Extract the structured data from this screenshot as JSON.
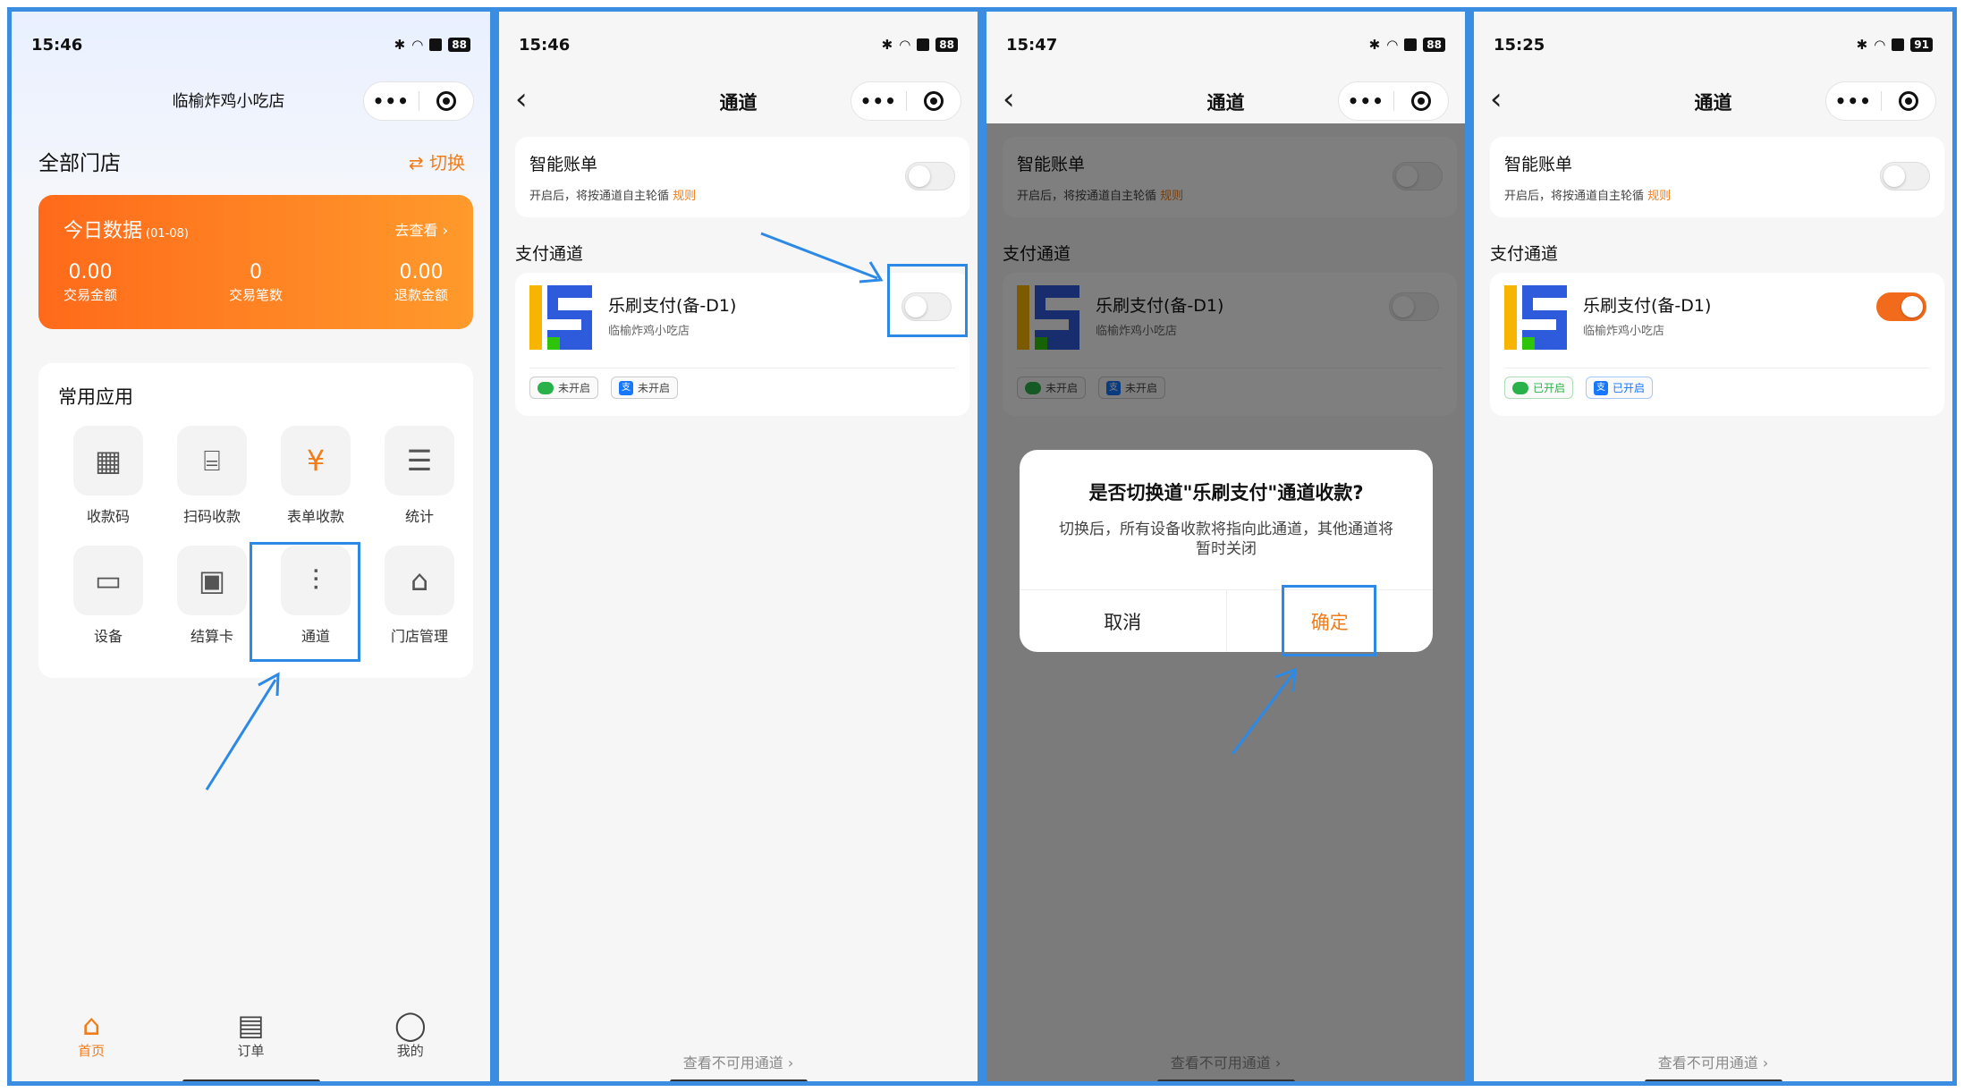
{
  "status": {
    "panel1": {
      "time": "15:46",
      "battery": "88"
    },
    "panel2": {
      "time": "15:46",
      "battery": "88"
    },
    "panel3": {
      "time": "15:47",
      "battery": "88"
    },
    "panel4": {
      "time": "15:25",
      "battery": "91"
    }
  },
  "home": {
    "store_name": "临榆炸鸡小吃店",
    "all_stores": "全部门店",
    "switch_label": "⇄ 切换",
    "today": {
      "title": "今日数据",
      "date": "(01-08)",
      "go": "去查看 ›",
      "stats": [
        {
          "value": "0.00",
          "label": "交易金额"
        },
        {
          "value": "0",
          "label": "交易笔数"
        },
        {
          "value": "0.00",
          "label": "退款金额"
        }
      ]
    },
    "apps_title": "常用应用",
    "apps": [
      {
        "label": "收款码",
        "icon": "qr-code-icon"
      },
      {
        "label": "扫码收款",
        "icon": "scan-icon"
      },
      {
        "label": "表单收款",
        "icon": "form-payment-icon"
      },
      {
        "label": "统计",
        "icon": "coins-stack-icon"
      },
      {
        "label": "设备",
        "icon": "device-icon"
      },
      {
        "label": "结算卡",
        "icon": "wallet-card-icon"
      },
      {
        "label": "通道",
        "icon": "channel-icon"
      },
      {
        "label": "门店管理",
        "icon": "store-icon"
      }
    ],
    "tabs": [
      {
        "label": "首页",
        "icon": "home-icon",
        "active": true
      },
      {
        "label": "订单",
        "icon": "order-icon",
        "active": false
      },
      {
        "label": "我的",
        "icon": "user-icon",
        "active": false
      }
    ]
  },
  "channel_page": {
    "title": "通道",
    "smart_bill": "智能账单",
    "smart_desc": "开启后，将按通道自主轮循",
    "rule_link": "规则",
    "section": "支付通道",
    "channel_name": "乐刷支付(备-D1)",
    "channel_store": "临榆炸鸡小吃店",
    "badge_off": "未开启",
    "badge_on": "已开启",
    "ali_char": "支",
    "footer_link": "查看不可用通道 ›"
  },
  "dialog": {
    "title": "是否切换道\"乐刷支付\"通道收款?",
    "desc": "切换后，所有设备收款将指向此通道，其他通道将暂时关闭",
    "cancel": "取消",
    "confirm": "确定"
  },
  "colors": {
    "accent": "#f07c1a",
    "highlight": "#2c8ae6",
    "toggle_on": "#f26b1d"
  }
}
